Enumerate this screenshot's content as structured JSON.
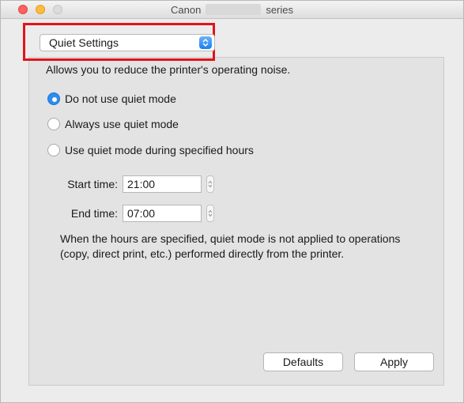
{
  "window": {
    "title_left": "Canon",
    "title_right": "series"
  },
  "settings_menu": {
    "selected": "Quiet Settings"
  },
  "description": "Allows you to reduce the printer's operating noise.",
  "quiet_mode": {
    "options": [
      {
        "label": "Do not use quiet mode",
        "checked": true
      },
      {
        "label": "Always use quiet mode",
        "checked": false
      },
      {
        "label": "Use quiet mode during specified hours",
        "checked": false
      }
    ]
  },
  "start_time": {
    "label": "Start time:",
    "value": "21:00"
  },
  "end_time": {
    "label": "End time:",
    "value": "07:00"
  },
  "note": "When the hours are specified, quiet mode is not applied to operations (copy, direct print, etc.) performed directly from the printer.",
  "buttons": {
    "defaults": "Defaults",
    "apply": "Apply"
  },
  "colors": {
    "accent": "#2d8cf0",
    "highlight": "#e0141a"
  }
}
